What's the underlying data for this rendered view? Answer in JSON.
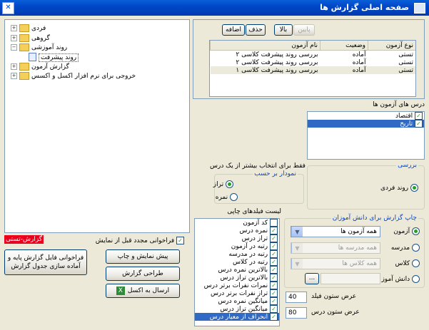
{
  "window": {
    "title": "صفحه اصلی گزارش ها",
    "close_label": "✕"
  },
  "tree": {
    "items": [
      {
        "label": "فردی",
        "expand": "+"
      },
      {
        "label": "گروهی",
        "expand": "+"
      },
      {
        "label": "روند آموزشی",
        "expand": "−"
      },
      {
        "label": "روند پیشرفت",
        "selected": true
      },
      {
        "label": "گزارش آزمون",
        "expand": "+"
      },
      {
        "label": "خروجی برای نرم افزار اکسل و اکسس",
        "expand": "+"
      }
    ]
  },
  "left_controls": {
    "status_label": "گزارش-تستی",
    "recall_checkbox_label": "فراخوانی مجدد قبل از نمایش",
    "recall_checked": true,
    "preview_print_button": "پیش نمایش و چاپ",
    "design_report_button": "طراحی گزارش",
    "send_excel_button": "ارسال به اکسل",
    "recall_base_button": "فراخوانی فایل گزارش پایه و آماده سازی جدول گزارش"
  },
  "grid_toolbar": {
    "down": "پایین",
    "up": "بالا",
    "delete": "حذف",
    "add": "اضافه"
  },
  "exam_grid": {
    "columns": [
      "نوع آزمون",
      "وضعیت",
      "نام آزمون"
    ],
    "rows": [
      [
        "تستی",
        "آماده",
        "بررسی روند پیشرفت کلاسی ۲"
      ],
      [
        "تستی",
        "آماده",
        "بررسی روند پیشرفت کلاسی ۲"
      ],
      [
        "تستی",
        "آماده",
        "بررسی روند پیشرفت کلاسی ۱"
      ]
    ]
  },
  "lessons": {
    "title": "درس های آزمون ها",
    "items": [
      {
        "label": "اقتصاد",
        "checked": true
      },
      {
        "label": "تاریخ",
        "checked": true,
        "selected": true
      }
    ]
  },
  "review": {
    "title": "بررسی",
    "option": "روند فردی"
  },
  "chart_based": {
    "note": "فقط برای انتخاب بیشتر از یک درس",
    "title": "نمودار بر حسب",
    "options": [
      "تراز",
      "نمره"
    ],
    "selected": 0
  },
  "print_fields": {
    "title": "لیست فیلدهای چاپی",
    "items": [
      {
        "label": "کد آزمون",
        "checked": false
      },
      {
        "label": "نمره درس",
        "checked": true
      },
      {
        "label": "تراز درس",
        "checked": true
      },
      {
        "label": "رتبه در آزمون",
        "checked": true
      },
      {
        "label": "رتبه در مدرسه",
        "checked": true
      },
      {
        "label": "رتبه در کلاس",
        "checked": true
      },
      {
        "label": "بالاترین نمره درس",
        "checked": true
      },
      {
        "label": "بالاترین تراز درس",
        "checked": true
      },
      {
        "label": "نمرات نفرات برتر درس",
        "checked": true
      },
      {
        "label": "تراز نفرات برتر درس",
        "checked": true
      },
      {
        "label": "میانگین نمره درس",
        "checked": true
      },
      {
        "label": "میانگین تراز درس",
        "checked": true
      },
      {
        "label": "انحراف از معیار درس",
        "checked": true,
        "selected": true
      }
    ]
  },
  "print_for": {
    "title": "چاپ گزارش برای دانش آموزان",
    "options": [
      {
        "label": "آزمون",
        "combo": "همه آزمون ها",
        "enabled": true
      },
      {
        "label": "مدرسه",
        "combo": "همه مدرسه ها",
        "enabled": false
      },
      {
        "label": "کلاس",
        "combo": "همه کلاس ها",
        "enabled": false
      },
      {
        "label": "دانش آموز",
        "combo": "",
        "enabled": false
      }
    ],
    "selected": 0,
    "browse_button": "..."
  },
  "widths": {
    "field_label": "عرض ستون فیلد",
    "field_value": "40",
    "lesson_label": "عرض ستون درس",
    "lesson_value": "80"
  },
  "colors": {
    "title_bar": "#0047c8",
    "status_badge": "#e8001c",
    "selection": "#316ac5"
  }
}
